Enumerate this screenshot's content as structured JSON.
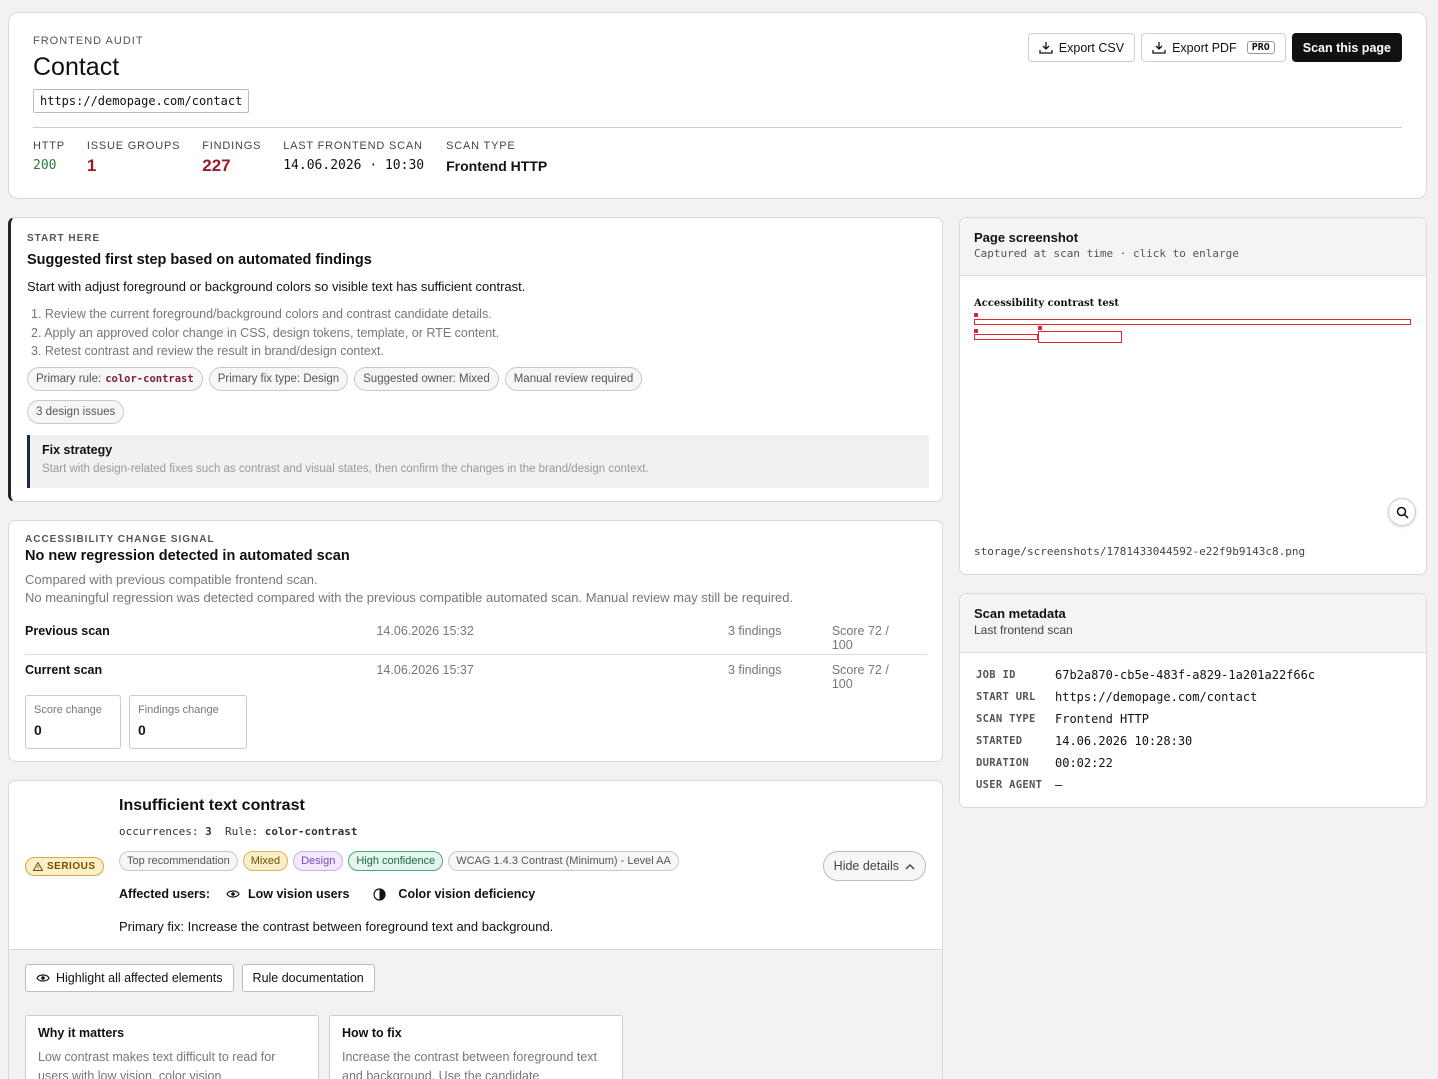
{
  "header": {
    "eyebrow": "FRONTEND AUDIT",
    "title": "Contact",
    "url": "https://demopage.com/contact",
    "actions": {
      "export_csv": "Export CSV",
      "export_pdf": "Export PDF",
      "pro_badge": "PRO",
      "scan": "Scan this page"
    },
    "stats": {
      "http_label": "HTTP",
      "http_value": "200",
      "groups_label": "ISSUE GROUPS",
      "groups_value": "1",
      "findings_label": "FINDINGS",
      "findings_value": "227",
      "last_scan_label": "LAST FRONTEND SCAN",
      "last_scan_value": "14.06.2026 · 10:30",
      "scan_type_label": "SCAN TYPE",
      "scan_type_value": "Frontend HTTP"
    }
  },
  "start_here": {
    "eyebrow": "START HERE",
    "title": "Suggested first step based on automated findings",
    "lead": "Start with adjust foreground or background colors so visible text has sufficient contrast.",
    "steps": [
      "1. Review the current foreground/background colors and contrast candidate details.",
      "2. Apply an approved color change in CSS, design tokens, template, or RTE content.",
      "3. Retest contrast and review the result in brand/design context."
    ],
    "chips": {
      "primary_rule_label": "Primary rule:",
      "primary_rule_value": "color-contrast",
      "fix_type": "Primary fix type: Design",
      "owner": "Suggested owner: Mixed",
      "manual": "Manual review required",
      "design_issues": "3 design issues"
    },
    "strategy": {
      "title": "Fix strategy",
      "text": "Start with design-related fixes such as contrast and visual states, then confirm the changes in the brand/design context."
    }
  },
  "change_signal": {
    "eyebrow": "ACCESSIBILITY CHANGE SIGNAL",
    "title": "No new regression detected in automated scan",
    "line1": "Compared with previous compatible frontend scan.",
    "line2": "No meaningful regression was detected compared with the previous compatible automated scan. Manual review may still be required.",
    "rows": [
      {
        "label": "Previous scan",
        "date": "14.06.2026 15:32",
        "findings": "3 findings",
        "score": "Score 72 / 100"
      },
      {
        "label": "Current scan",
        "date": "14.06.2026 15:37",
        "findings": "3 findings",
        "score": "Score 72 / 100"
      }
    ],
    "score_change_label": "Score change",
    "score_change_value": "0",
    "findings_change_label": "Findings change",
    "findings_change_value": "0"
  },
  "issue": {
    "severity": "SERIOUS",
    "title": "Insufficient text contrast",
    "occurrences_label": "occurrences:",
    "occurrences_value": "3",
    "rule_label": "Rule:",
    "rule_value": "color-contrast",
    "tags": [
      "Top recommendation",
      "Mixed",
      "Design",
      "High confidence",
      "WCAG 1.4.3 Contrast (Minimum) - Level AA"
    ],
    "hide_details": "Hide details",
    "affected_label": "Affected users:",
    "affected": [
      "Low vision users",
      "Color vision deficiency"
    ],
    "primary_fix": "Primary fix: Increase the contrast between foreground text and background.",
    "highlight_btn": "Highlight all affected elements",
    "docs_btn": "Rule documentation",
    "why_title": "Why it matters",
    "why_text": "Low contrast makes text difficult to read for users with low vision, color vision",
    "how_title": "How to fix",
    "how_text": "Increase the contrast between foreground text and background. Use the candidate"
  },
  "screenshot": {
    "title": "Page screenshot",
    "subtitle": "Captured at scan time · click to enlarge",
    "preview_title": "Accessibility contrast test",
    "path": "storage/screenshots/1781433044592-e22f9b9143c8.png"
  },
  "metadata": {
    "title": "Scan metadata",
    "subtitle": "Last frontend scan",
    "rows": [
      {
        "k": "JOB ID",
        "v": "67b2a870-cb5e-483f-a829-1a201a22f66c"
      },
      {
        "k": "START URL",
        "v": "https://demopage.com/contact"
      },
      {
        "k": "SCAN TYPE",
        "v": "Frontend HTTP"
      },
      {
        "k": "STARTED",
        "v": "14.06.2026 10:28:30"
      },
      {
        "k": "DURATION",
        "v": "00:02:22"
      },
      {
        "k": "USER AGENT",
        "v": "—"
      }
    ]
  }
}
